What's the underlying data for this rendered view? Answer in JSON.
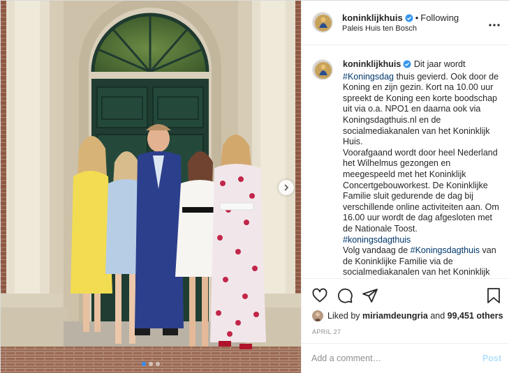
{
  "post": {
    "photo_alt": "",
    "carousel": {
      "count": 3,
      "active_index": 0
    }
  },
  "header": {
    "username": "koninklijkhuis",
    "dot": "•",
    "follow_state": "Following",
    "location": "Paleis Huis ten Bosch"
  },
  "caption": {
    "username": "koninklijkhuis",
    "segments": [
      {
        "type": "text",
        "value": " Dit jaar wordt "
      },
      {
        "type": "tag",
        "value": "#Koningsdag"
      },
      {
        "type": "text",
        "value": " thuis gevierd. Ook door de Koning en zijn gezin. Kort na 10.00 uur spreekt de Koning een korte boodschap uit via o.a. NPO1 en daarna ook via Koningsdagthuis.nl en de socialmediakanalen van het Koninklijk Huis."
      },
      {
        "type": "br"
      },
      {
        "type": "text",
        "value": "Voorafgaand wordt door heel Nederland het Wilhelmus gezongen en meegespeeld met het Koninklijk Concertgebouworkest. De Koninklijke Familie sluit gedurende de dag bij verschillende online activiteiten aan. Om 16.00 uur wordt de dag afgesloten met de Nationale Toost."
      },
      {
        "type": "br"
      },
      {
        "type": "tag",
        "value": "#koningsdagthuis"
      },
      {
        "type": "br"
      },
      {
        "type": "text",
        "value": "Volg vandaag de "
      },
      {
        "type": "tag",
        "value": "#Koningsdagthuis"
      },
      {
        "type": "text",
        "value": " van de Koninklijke Familie via de socialmediakanalen van het Koninklijk Huis."
      }
    ]
  },
  "likes": {
    "prefix": "Liked by ",
    "liker": "miriamdeungria",
    "joiner": " and ",
    "others": "99,451 others"
  },
  "date": "APRIL 27",
  "comment": {
    "placeholder": "Add a comment…",
    "post_label": "Post"
  },
  "colors": {
    "link": "#00376b",
    "verified": "#3897f0",
    "post_disabled": "#b2dffc",
    "active_dot": "#2f8cff"
  },
  "icons": [
    "verified-icon",
    "more-options-icon",
    "chevron-right-icon",
    "heart-icon",
    "comment-icon",
    "share-icon",
    "bookmark-icon"
  ]
}
